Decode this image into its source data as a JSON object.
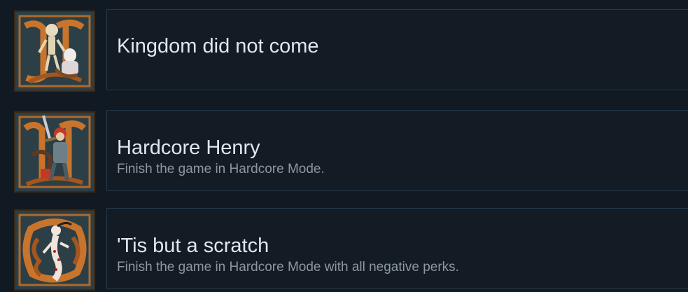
{
  "achievements": [
    {
      "title": "Kingdom did not come",
      "description": "",
      "icon": "skeleton-illuminated-letter-icon"
    },
    {
      "title": "Hardcore Henry",
      "description": "Finish the game in Hardcore Mode.",
      "icon": "knight-sword-illuminated-letter-icon"
    },
    {
      "title": "'Tis but a scratch",
      "description": "Finish the game in Hardcore Mode with all negative perks.",
      "icon": "wounded-figure-illuminated-letter-icon"
    }
  ]
}
